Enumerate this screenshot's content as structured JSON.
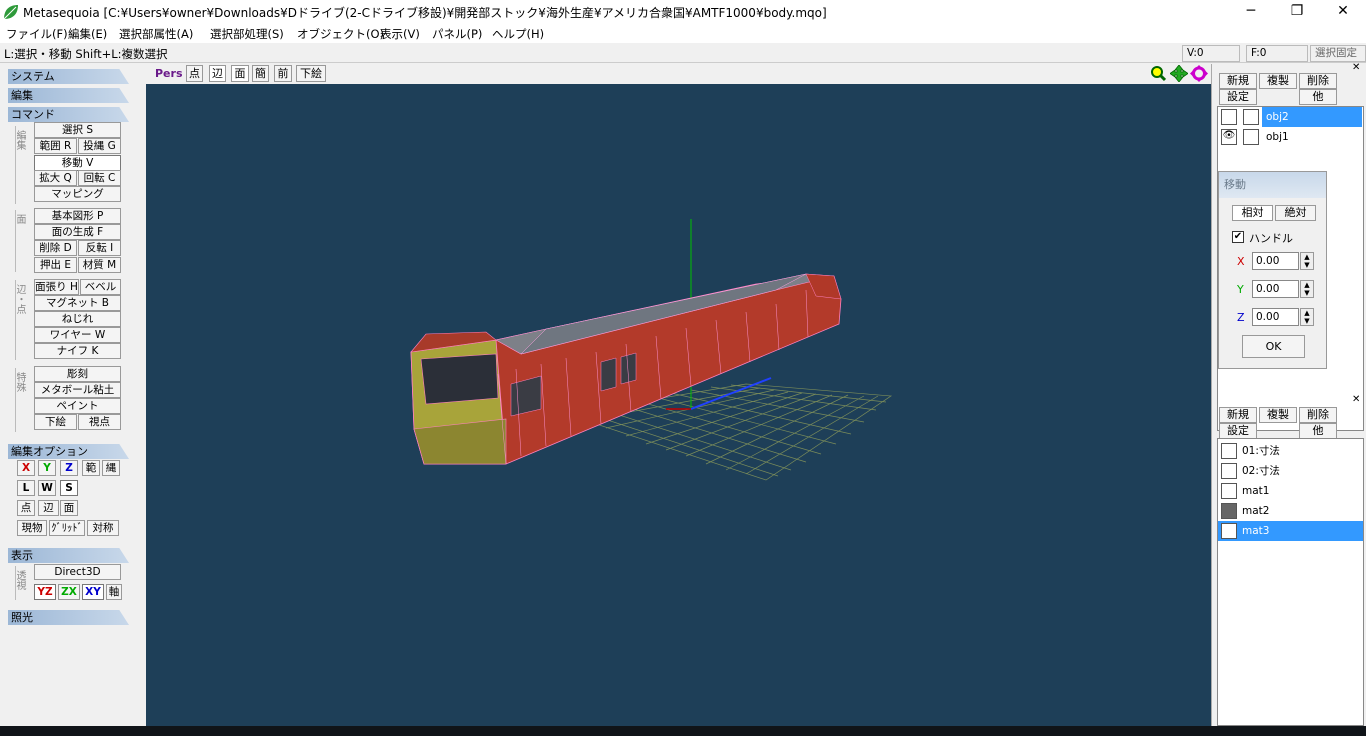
{
  "window": {
    "title": "Metasequoia [C:¥Users¥owner¥Downloads¥Dドライブ(2-Cドライブ移設)¥開発部ストック¥海外生産¥アメリカ合衆国¥AMTF1000¥body.mqo]",
    "minimize": "─",
    "maximize": "❐",
    "close": "✕"
  },
  "menu": [
    "ファイル(F)",
    "編集(E)",
    "選択部属性(A)",
    "選択部処理(S)",
    "オブジェクト(O)",
    "表示(V)",
    "パネル(P)",
    "ヘルプ(H)"
  ],
  "status": {
    "hint": "L:選択・移動  Shift+L:複数選択",
    "vertices": "V:0",
    "faces": "F:0",
    "select_lock": "選択固定"
  },
  "left": {
    "sections": {
      "system": "システム",
      "edit": "編集",
      "command": "コマンド",
      "edit_options": "編集オプション",
      "display": "表示",
      "lighting": "照光"
    },
    "groups": {
      "edit": "編集",
      "face": "面",
      "edge_point": "辺・点",
      "special": "特殊",
      "render": "透視"
    },
    "commands": {
      "select": "選択 S",
      "range": "範囲 R",
      "lasso": "投縄 G",
      "move": "移動 V",
      "scale": "拡大 Q",
      "rotate": "回転 C",
      "mapping": "マッピング",
      "primitive": "基本図形 P",
      "face_gen": "面の生成 F",
      "delete": "削除 D",
      "invert": "反転 I",
      "extrude": "押出 E",
      "material": "材質 M",
      "stretch": "面張り H",
      "bevel": "ベベル",
      "magnet": "マグネット B",
      "twist": "ねじれ",
      "wire": "ワイヤー W",
      "knife": "ナイフ K",
      "sculpt": "彫刻",
      "metaball": "メタボール粘土",
      "paint": "ペイント",
      "underlay": "下絵",
      "viewpoint": "視点"
    },
    "options": {
      "x": "X",
      "y": "Y",
      "z": "Z",
      "range": "範",
      "lasso": "縄",
      "l": "L",
      "w": "W",
      "s": "S",
      "point": "点",
      "edge": "辺",
      "face": "面",
      "current": "現物",
      "grid": "ｸﾞﾘｯﾄﾞ",
      "symmetry": "対称"
    },
    "display": {
      "direct3d": "Direct3D",
      "yz": "YZ",
      "zx": "ZX",
      "xy": "XY",
      "axis": "軸"
    }
  },
  "viewport_toolbar": {
    "pers": "Pers",
    "point": "点",
    "edge": "辺",
    "face": "面",
    "simple": "簡",
    "front": "前",
    "underlay": "下絵"
  },
  "objects_panel": {
    "new": "新規",
    "duplicate": "複製",
    "delete": "削除",
    "settings": "設定",
    "other": "他",
    "items": [
      "obj2",
      "obj1"
    ],
    "selected": "obj2"
  },
  "move_panel": {
    "title": "移動",
    "relative": "相対",
    "absolute": "絶対",
    "handle": "ハンドル",
    "x_label": "X",
    "y_label": "Y",
    "z_label": "Z",
    "x": "0.00",
    "y": "0.00",
    "z": "0.00",
    "ok": "OK"
  },
  "materials_panel": {
    "new": "新規",
    "duplicate": "複製",
    "delete": "削除",
    "settings": "設定",
    "other": "他",
    "items": [
      "01:寸法",
      "02:寸法",
      "mat1",
      "mat2",
      "mat3"
    ],
    "selected": "mat3"
  },
  "colors": {
    "viewport_bg": "#1e3f58",
    "selection": "#3399ff",
    "axis_x": "#cc0000",
    "axis_y": "#00aa00",
    "axis_z": "#0000cc"
  }
}
